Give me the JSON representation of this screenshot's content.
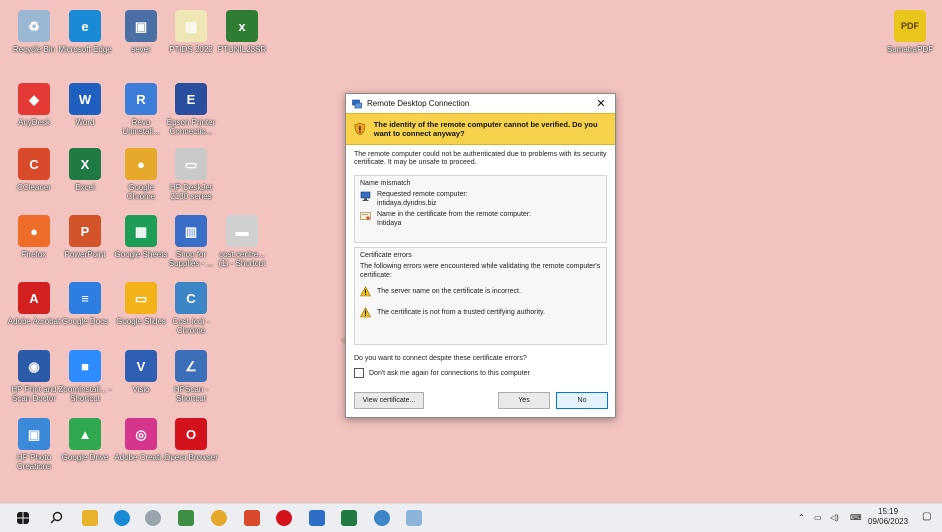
{
  "desktop": {
    "icons": [
      {
        "label": "Recycle Bin",
        "color": "#9bb7d4",
        "glyph": "♻"
      },
      {
        "label": "Microsoft Edge",
        "color": "#1b8ad6",
        "glyph": "e"
      },
      {
        "label": "sever",
        "color": "#4a6fa5",
        "glyph": "▣"
      },
      {
        "label": "PTIDS 2022",
        "color": "#efe6b6",
        "glyph": "▤"
      },
      {
        "label": "PTUNIL23SR",
        "color": "#2e7d32",
        "glyph": "x"
      },
      {
        "label": "AnyDesk",
        "color": "#e53935",
        "glyph": "◆"
      },
      {
        "label": "Word",
        "color": "#1e5fbf",
        "glyph": "W"
      },
      {
        "label": "Revo Uninstall...",
        "color": "#3b7dd8",
        "glyph": "R"
      },
      {
        "label": "Epson Printer Connectio...",
        "color": "#2a4f9e",
        "glyph": "E"
      },
      {
        "label": "CCleaner",
        "color": "#d84a2a",
        "glyph": "C"
      },
      {
        "label": "Excel",
        "color": "#1f7a43",
        "glyph": "X"
      },
      {
        "label": "Google Chrome",
        "color": "#e5a82a",
        "glyph": "●"
      },
      {
        "label": "HP DeskJet 2130 series",
        "color": "#c9c9c9",
        "glyph": "▭"
      },
      {
        "label": "Firefox",
        "color": "#ef6d2a",
        "glyph": "●"
      },
      {
        "label": "PowerPoint",
        "color": "#d3542b",
        "glyph": "P"
      },
      {
        "label": "Google Sheets",
        "color": "#1e9d58",
        "glyph": "▦"
      },
      {
        "label": "Shop for Supplies - ...",
        "color": "#3a6dc8",
        "glyph": "▥"
      },
      {
        "label": "cost.centre... (1) - Shortcut",
        "color": "#d0d0d0",
        "glyph": "▬"
      },
      {
        "label": "Adobe Acrobat",
        "color": "#d32020",
        "glyph": "A"
      },
      {
        "label": "Google Docs",
        "color": "#2e7de0",
        "glyph": "≡"
      },
      {
        "label": "Google Slides",
        "color": "#f2b31a",
        "glyph": "▭"
      },
      {
        "label": "Cost (cc) - Chrome",
        "color": "#3d86c6",
        "glyph": "C"
      },
      {
        "label": "HP Print and Scan Doctor",
        "color": "#2b5aa8",
        "glyph": "◉"
      },
      {
        "label": "ZoomInstall... - Shortcut",
        "color": "#2d8cff",
        "glyph": "■"
      },
      {
        "label": "Visio",
        "color": "#2f5fb3",
        "glyph": "V"
      },
      {
        "label": "HPScan - Shortcut",
        "color": "#3c6fb8",
        "glyph": "∠"
      },
      {
        "label": "HP Photo Creations",
        "color": "#3c89d9",
        "glyph": "▣"
      },
      {
        "label": "Google Drive",
        "color": "#2fa84f",
        "glyph": "▲"
      },
      {
        "label": "Adobe Creati...",
        "color": "#d6358e",
        "glyph": "◎"
      },
      {
        "label": "Opera Browser",
        "color": "#d3121e",
        "glyph": "O"
      },
      {
        "label": "SumatraPDF",
        "color": "#e8c61c",
        "glyph": "PDF"
      }
    ]
  },
  "dialog": {
    "title": "Remote Desktop Connection",
    "close": "✕",
    "warning": "The identity of the remote computer cannot be verified. Do you want to connect anyway?",
    "description": "The remote computer could not be authenticated due to problems with its security certificate. It may be unsafe to proceed.",
    "name_mismatch": {
      "title": "Name mismatch",
      "requested_label": "Requested remote computer:",
      "requested_value": "intidaya.dyndns.biz",
      "cert_label": "Name in the certificate from the remote computer:",
      "cert_value": "Intidaya"
    },
    "cert_errors": {
      "title": "Certificate errors",
      "intro": "The following errors were encountered while validating the remote computer's certificate:",
      "errors": [
        "The server name on the certificate is incorrect.",
        "The certificate is not from a trusted certifying authority."
      ]
    },
    "question": "Do you want to connect despite these certificate errors?",
    "checkbox": "Don't ask me again for connections to this computer",
    "view_cert": "View certificate...",
    "yes": "Yes",
    "no": "No"
  },
  "taskbar": {
    "time": "15:19",
    "date": "09/06/2023"
  }
}
